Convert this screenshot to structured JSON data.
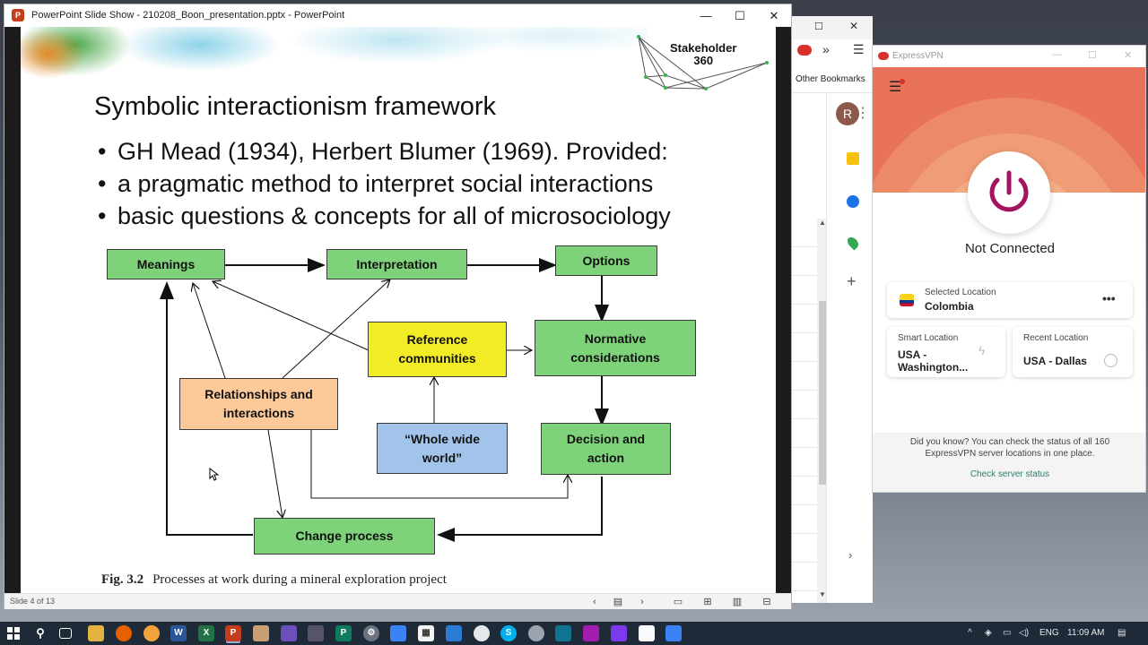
{
  "powerpoint": {
    "window_title": "PowerPoint Slide Show  -  210208_Boon_presentation.pptx  -  PowerPoint",
    "logo_letter": "P",
    "slide": {
      "logo_text_line1": "Stakeholder",
      "logo_text_line2": "360",
      "title": "Symbolic interactionism framework",
      "bullets": [
        "GH Mead (1934), Herbert Blumer (1969). Provided:",
        "a pragmatic method to interpret social interactions",
        "basic questions & concepts for all of microsociology"
      ],
      "diagram": {
        "meanings": "Meanings",
        "interpretation": "Interpretation",
        "options": "Options",
        "reference_line1": "Reference",
        "reference_line2": "communities",
        "normative_line1": "Normative",
        "normative_line2": "considerations",
        "relationships_line1": "Relationships and",
        "relationships_line2": "interactions",
        "whole_line1": "“Whole wide",
        "whole_line2": "world”",
        "decision_line1": "Decision and",
        "decision_line2": "action",
        "change": "Change process"
      },
      "caption_label": "Fig. 3.2",
      "caption_text": "Processes at work during a mineral exploration project"
    },
    "status_text": "Slide 4 of 13"
  },
  "browser": {
    "bookmarks_label": "Other Bookmarks",
    "profile_initial": "R"
  },
  "expressvpn": {
    "window_title": "ExpressVPN",
    "status": "Not Connected",
    "selected_location_label": "Selected Location",
    "selected_location_value": "Colombia",
    "smart_location_label": "Smart Location",
    "smart_location_line1": "USA -",
    "smart_location_line2": "Washington...",
    "recent_location_label": "Recent Location",
    "recent_location_value": "USA - Dallas",
    "tip_text": "Did you know? You can check the status of all 160 ExpressVPN server locations in one place.",
    "link_text": "Check server status",
    "colors": {
      "hero_outer": "#e8735a",
      "hero_inner": "#f2a47c",
      "accent": "#a4135f"
    }
  },
  "taskbar": {
    "language": "ENG",
    "time": "11:09 AM"
  }
}
